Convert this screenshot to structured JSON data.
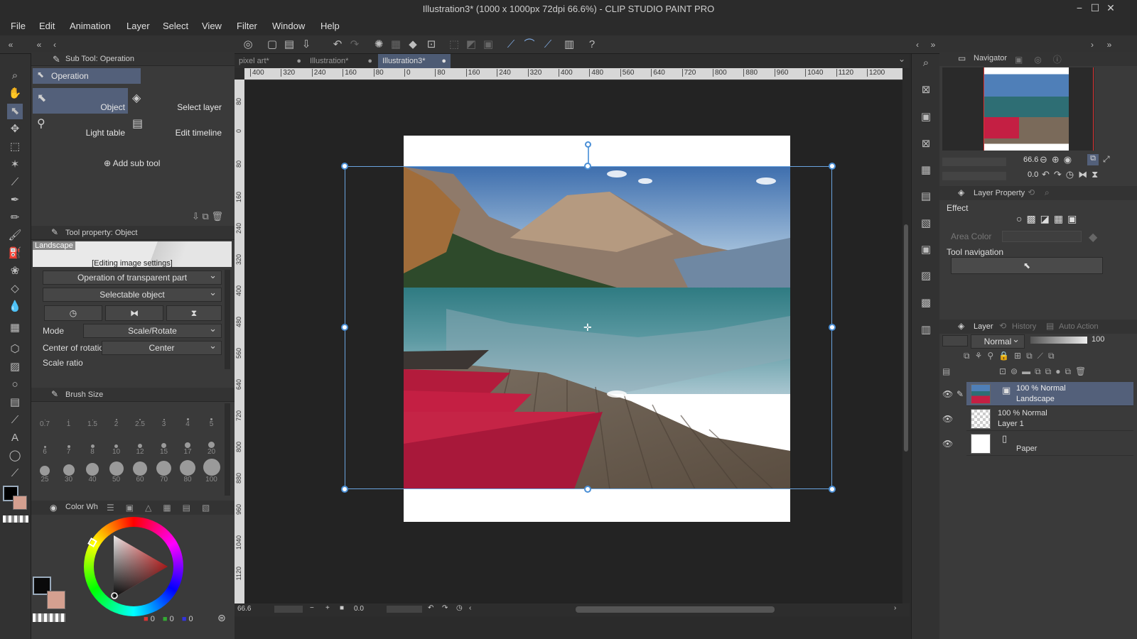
{
  "window": {
    "title": "Illustration3* (1000 x 1000px 72dpi 66.6%) - CLIP STUDIO PAINT PRO",
    "controls": [
      "−",
      "☐",
      "✕"
    ]
  },
  "menu": [
    "File",
    "Edit",
    "Animation",
    "Layer",
    "Select",
    "View",
    "Filter",
    "Window",
    "Help"
  ],
  "subtool": {
    "header": "Sub Tool: Operation",
    "group": "Operation",
    "items": [
      {
        "label": "Object",
        "selected": true
      },
      {
        "label": "Select layer",
        "selected": false
      },
      {
        "label": "Light table",
        "selected": false
      },
      {
        "label": "Edit timeline",
        "selected": false
      }
    ],
    "add_label": "Add sub tool"
  },
  "toolprop": {
    "header": "Tool property: Object",
    "layer_name": "Landscape",
    "editing": "[Editing image settings]",
    "transparent_op": "Operation of transparent part",
    "selectable": "Selectable object",
    "mode_label": "Mode",
    "mode_value": "Scale/Rotate",
    "center_label": "Center of rotation",
    "center_value": "Center",
    "scale_label": "Scale ratio"
  },
  "brushsize": {
    "header": "Brush Size",
    "sizes": [
      "0.7",
      "1",
      "1.5",
      "2",
      "2.5",
      "3",
      "4",
      "5",
      "6",
      "7",
      "8",
      "10",
      "12",
      "15",
      "17",
      "20",
      "25",
      "30",
      "40",
      "50",
      "60",
      "70",
      "80",
      "100"
    ]
  },
  "colorwheel": {
    "header": "Color Wh",
    "rgb": [
      "0",
      "0",
      "0"
    ],
    "main_color": "#0a0a0a",
    "sub_color": "#d4a090"
  },
  "tabs": [
    {
      "label": "pixel art*",
      "active": false
    },
    {
      "label": "Illustration*",
      "active": false
    },
    {
      "label": "Illustration3*",
      "active": true
    }
  ],
  "ruler_h": [
    "400",
    "320",
    "240",
    "160",
    "80",
    "0",
    "80",
    "160",
    "240",
    "320",
    "400",
    "480",
    "560",
    "640",
    "720",
    "800",
    "880",
    "960",
    "1040",
    "1120",
    "1200"
  ],
  "ruler_v": [
    "80",
    "0",
    "80",
    "160",
    "240",
    "320",
    "400",
    "480",
    "560",
    "640",
    "720",
    "800",
    "880",
    "960",
    "1040",
    "1120"
  ],
  "status": {
    "zoom": "66.6",
    "angle": "0.0"
  },
  "navigator": {
    "header": "Navigator",
    "zoom": "66.6",
    "angle": "0.0"
  },
  "layerprop": {
    "header": "Layer Property",
    "effect_label": "Effect",
    "area_color_label": "Area Color",
    "toolnav_label": "Tool navigation"
  },
  "layers": {
    "tabs": [
      "Layer",
      "History",
      "Auto Action"
    ],
    "blend_mode": "Normal",
    "opacity": "100",
    "rows": [
      {
        "mode": "100 % Normal",
        "name": "Landscape",
        "selected": true
      },
      {
        "mode": "100 % Normal",
        "name": "Layer 1",
        "selected": false
      },
      {
        "mode": "",
        "name": "Paper",
        "selected": false
      }
    ]
  }
}
